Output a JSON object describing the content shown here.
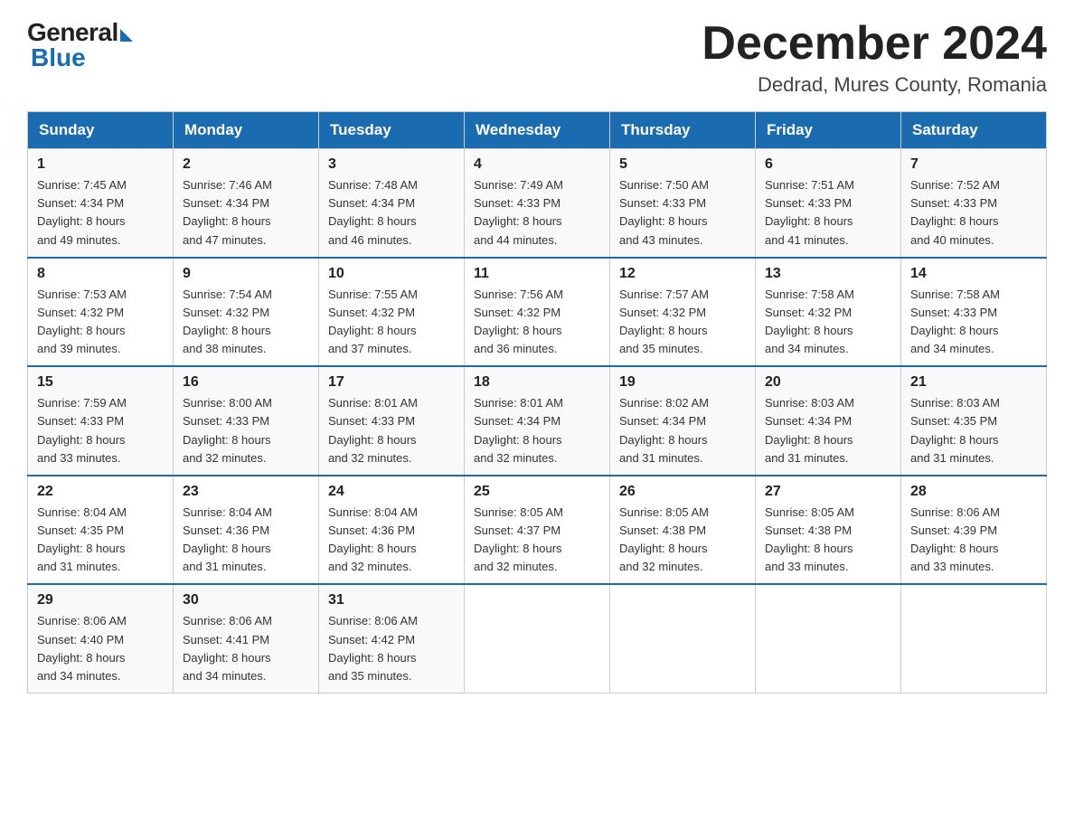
{
  "logo": {
    "general": "General",
    "blue": "Blue"
  },
  "header": {
    "month": "December 2024",
    "location": "Dedrad, Mures County, Romania"
  },
  "days_of_week": [
    "Sunday",
    "Monday",
    "Tuesday",
    "Wednesday",
    "Thursday",
    "Friday",
    "Saturday"
  ],
  "weeks": [
    [
      {
        "num": "1",
        "sunrise": "7:45 AM",
        "sunset": "4:34 PM",
        "daylight": "8 hours and 49 minutes."
      },
      {
        "num": "2",
        "sunrise": "7:46 AM",
        "sunset": "4:34 PM",
        "daylight": "8 hours and 47 minutes."
      },
      {
        "num": "3",
        "sunrise": "7:48 AM",
        "sunset": "4:34 PM",
        "daylight": "8 hours and 46 minutes."
      },
      {
        "num": "4",
        "sunrise": "7:49 AM",
        "sunset": "4:33 PM",
        "daylight": "8 hours and 44 minutes."
      },
      {
        "num": "5",
        "sunrise": "7:50 AM",
        "sunset": "4:33 PM",
        "daylight": "8 hours and 43 minutes."
      },
      {
        "num": "6",
        "sunrise": "7:51 AM",
        "sunset": "4:33 PM",
        "daylight": "8 hours and 41 minutes."
      },
      {
        "num": "7",
        "sunrise": "7:52 AM",
        "sunset": "4:33 PM",
        "daylight": "8 hours and 40 minutes."
      }
    ],
    [
      {
        "num": "8",
        "sunrise": "7:53 AM",
        "sunset": "4:32 PM",
        "daylight": "8 hours and 39 minutes."
      },
      {
        "num": "9",
        "sunrise": "7:54 AM",
        "sunset": "4:32 PM",
        "daylight": "8 hours and 38 minutes."
      },
      {
        "num": "10",
        "sunrise": "7:55 AM",
        "sunset": "4:32 PM",
        "daylight": "8 hours and 37 minutes."
      },
      {
        "num": "11",
        "sunrise": "7:56 AM",
        "sunset": "4:32 PM",
        "daylight": "8 hours and 36 minutes."
      },
      {
        "num": "12",
        "sunrise": "7:57 AM",
        "sunset": "4:32 PM",
        "daylight": "8 hours and 35 minutes."
      },
      {
        "num": "13",
        "sunrise": "7:58 AM",
        "sunset": "4:32 PM",
        "daylight": "8 hours and 34 minutes."
      },
      {
        "num": "14",
        "sunrise": "7:58 AM",
        "sunset": "4:33 PM",
        "daylight": "8 hours and 34 minutes."
      }
    ],
    [
      {
        "num": "15",
        "sunrise": "7:59 AM",
        "sunset": "4:33 PM",
        "daylight": "8 hours and 33 minutes."
      },
      {
        "num": "16",
        "sunrise": "8:00 AM",
        "sunset": "4:33 PM",
        "daylight": "8 hours and 32 minutes."
      },
      {
        "num": "17",
        "sunrise": "8:01 AM",
        "sunset": "4:33 PM",
        "daylight": "8 hours and 32 minutes."
      },
      {
        "num": "18",
        "sunrise": "8:01 AM",
        "sunset": "4:34 PM",
        "daylight": "8 hours and 32 minutes."
      },
      {
        "num": "19",
        "sunrise": "8:02 AM",
        "sunset": "4:34 PM",
        "daylight": "8 hours and 31 minutes."
      },
      {
        "num": "20",
        "sunrise": "8:03 AM",
        "sunset": "4:34 PM",
        "daylight": "8 hours and 31 minutes."
      },
      {
        "num": "21",
        "sunrise": "8:03 AM",
        "sunset": "4:35 PM",
        "daylight": "8 hours and 31 minutes."
      }
    ],
    [
      {
        "num": "22",
        "sunrise": "8:04 AM",
        "sunset": "4:35 PM",
        "daylight": "8 hours and 31 minutes."
      },
      {
        "num": "23",
        "sunrise": "8:04 AM",
        "sunset": "4:36 PM",
        "daylight": "8 hours and 31 minutes."
      },
      {
        "num": "24",
        "sunrise": "8:04 AM",
        "sunset": "4:36 PM",
        "daylight": "8 hours and 32 minutes."
      },
      {
        "num": "25",
        "sunrise": "8:05 AM",
        "sunset": "4:37 PM",
        "daylight": "8 hours and 32 minutes."
      },
      {
        "num": "26",
        "sunrise": "8:05 AM",
        "sunset": "4:38 PM",
        "daylight": "8 hours and 32 minutes."
      },
      {
        "num": "27",
        "sunrise": "8:05 AM",
        "sunset": "4:38 PM",
        "daylight": "8 hours and 33 minutes."
      },
      {
        "num": "28",
        "sunrise": "8:06 AM",
        "sunset": "4:39 PM",
        "daylight": "8 hours and 33 minutes."
      }
    ],
    [
      {
        "num": "29",
        "sunrise": "8:06 AM",
        "sunset": "4:40 PM",
        "daylight": "8 hours and 34 minutes."
      },
      {
        "num": "30",
        "sunrise": "8:06 AM",
        "sunset": "4:41 PM",
        "daylight": "8 hours and 34 minutes."
      },
      {
        "num": "31",
        "sunrise": "8:06 AM",
        "sunset": "4:42 PM",
        "daylight": "8 hours and 35 minutes."
      },
      null,
      null,
      null,
      null
    ]
  ],
  "labels": {
    "sunrise": "Sunrise:",
    "sunset": "Sunset:",
    "daylight": "Daylight:"
  }
}
